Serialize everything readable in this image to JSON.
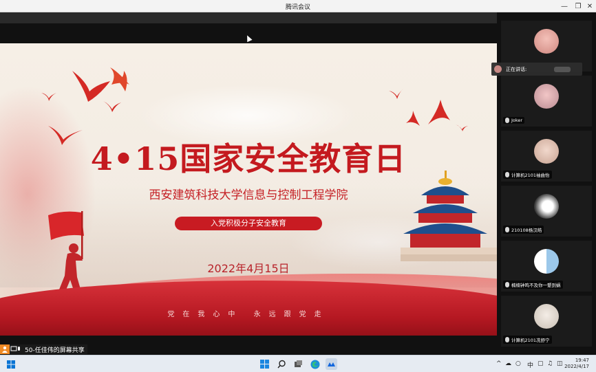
{
  "window": {
    "title": "腾讯会议"
  },
  "slide": {
    "main_title": "4•15国家安全教育日",
    "subtitle": "西安建筑科技大学信息与控制工程学院",
    "pill_label": "入党积极分子安全教育",
    "date": "2022年4月15日",
    "motto": "党在我心中 永远跟党走"
  },
  "share": {
    "label": "50-任佳伟的屏幕共享"
  },
  "speaking": {
    "label": "正在讲话:"
  },
  "participants": [
    {
      "name": ""
    },
    {
      "name": "Joker"
    },
    {
      "name": "计算机2101袖曲怡"
    },
    {
      "name": "210108杨汉皓"
    },
    {
      "name": "楠楠钟鸣不及你一颦到蜗"
    },
    {
      "name": "计算机2101冼舒宁"
    }
  ],
  "taskbar": {
    "lang": "中",
    "time": "19:47",
    "date": "2022/4/17"
  },
  "colors": {
    "accent_red": "#c41a1f",
    "tencent_orange": "#f08a24"
  }
}
